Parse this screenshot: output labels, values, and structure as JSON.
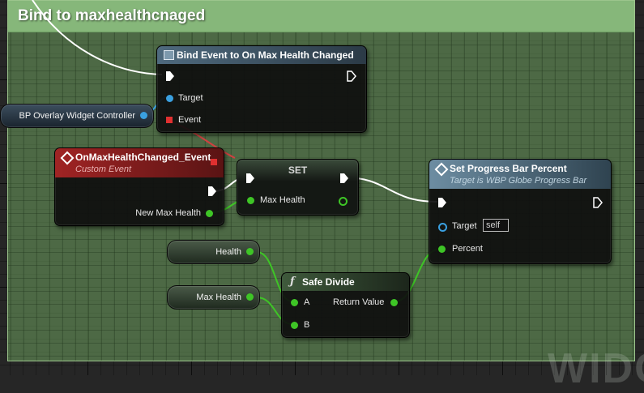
{
  "comment": {
    "title": "Bind to maxhealthcnaged"
  },
  "bind_event_node": {
    "title": "Bind Event to On Max Health Changed",
    "pin_target": "Target",
    "pin_event": "Event"
  },
  "controller_var": {
    "label": "BP Overlay Widget Controller"
  },
  "custom_event_node": {
    "title": "OnMaxHealthChanged_Event",
    "subtitle": "Custom Event",
    "pin_new_max_health": "New Max Health"
  },
  "set_node": {
    "title": "SET",
    "pin_max_health": "Max Health"
  },
  "progress_node": {
    "title": "Set Progress Bar Percent",
    "subtitle": "Target is WBP Globe Progress Bar",
    "pin_target": "Target",
    "target_value": "self",
    "pin_percent": "Percent"
  },
  "health_var": {
    "label": "Health"
  },
  "max_health_var": {
    "label": "Max Health"
  },
  "safe_divide_node": {
    "title": "Safe Divide",
    "pin_a": "A",
    "pin_b": "B",
    "pin_return": "Return Value"
  },
  "watermark": "WIDG",
  "colors": {
    "exec": "#ffffff",
    "float_pin": "#3ec526",
    "object_pin": "#3aa0e0",
    "event_pin": "#e03030",
    "comment": "#86b77a",
    "custom_event_header": "#8b1d1d",
    "function_header": "#5f7f93"
  }
}
